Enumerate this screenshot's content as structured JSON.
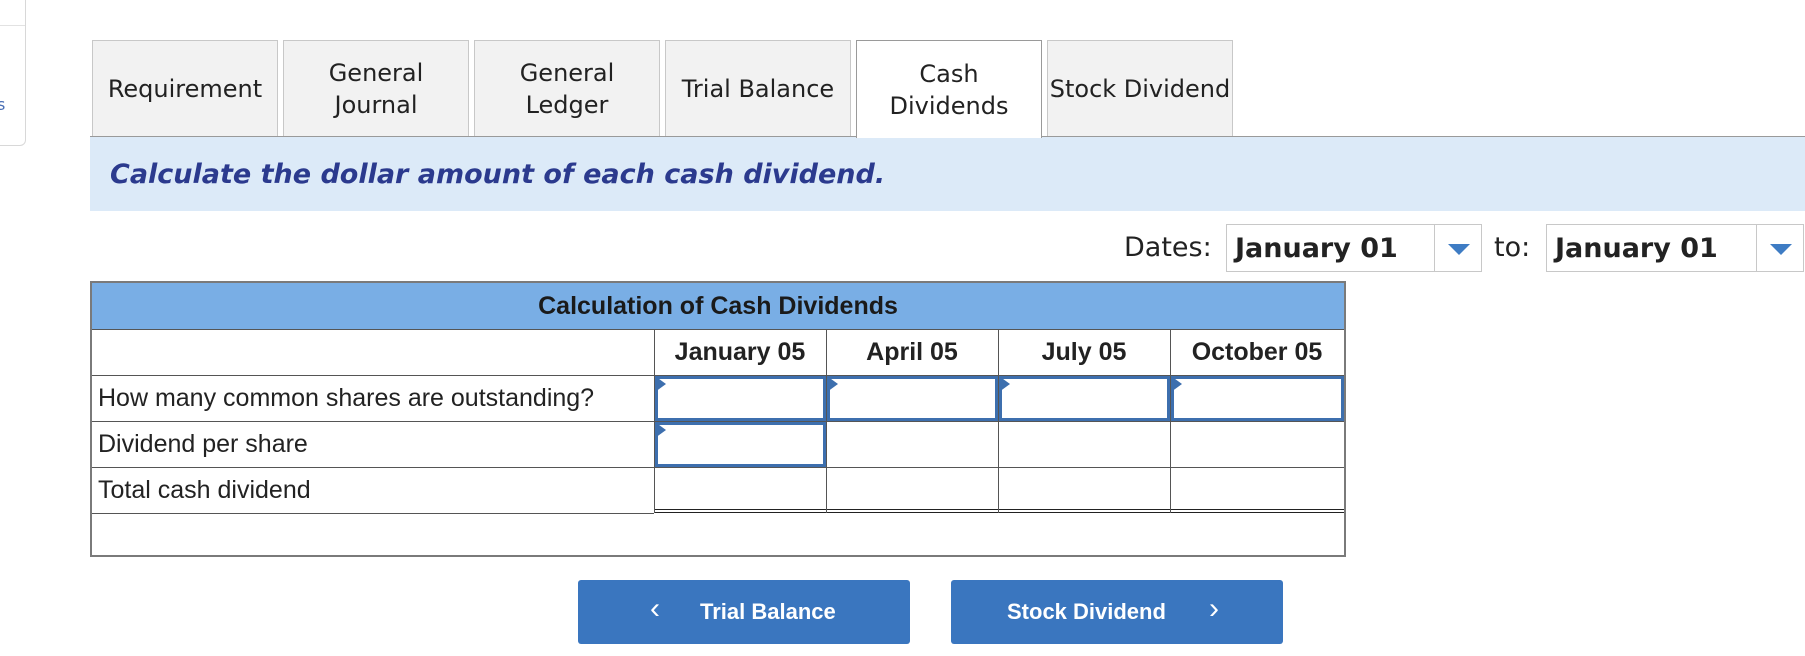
{
  "tabs": [
    {
      "label": "Requirement",
      "active": false
    },
    {
      "label": "General\nJournal",
      "active": false
    },
    {
      "label": "General\nLedger",
      "active": false
    },
    {
      "label": "Trial Balance",
      "active": false
    },
    {
      "label": "Cash\nDividends",
      "active": true
    },
    {
      "label": "Stock Dividend",
      "active": false
    }
  ],
  "banner": {
    "instruction": "Calculate the dollar amount of each cash dividend."
  },
  "dates": {
    "label": "Dates:",
    "from_value": "January 01",
    "to_label": "to:",
    "to_value": "January 01"
  },
  "table": {
    "title": "Calculation of Cash Dividends",
    "columns": [
      "January 05",
      "April 05",
      "July 05",
      "October 05"
    ],
    "rows": [
      {
        "label": "How many common shares are outstanding?",
        "values": [
          "",
          "",
          "",
          ""
        ]
      },
      {
        "label": "Dividend per share",
        "values": [
          "",
          "",
          "",
          ""
        ]
      },
      {
        "label": "Total cash dividend",
        "values": [
          "",
          "",
          "",
          ""
        ]
      }
    ]
  },
  "nav": {
    "prev_label": "Trial Balance",
    "next_label": "Stock Dividend"
  },
  "icons": {
    "dropdown": "triangle-down-icon",
    "prev": "chevron-left-icon",
    "next": "chevron-right-icon"
  },
  "colors": {
    "banner_bg": "#dceaf8",
    "banner_text": "#2b3a8e",
    "table_header_bg": "#79aee5",
    "accent": "#3a76bf",
    "input_border": "#3d6fae"
  }
}
